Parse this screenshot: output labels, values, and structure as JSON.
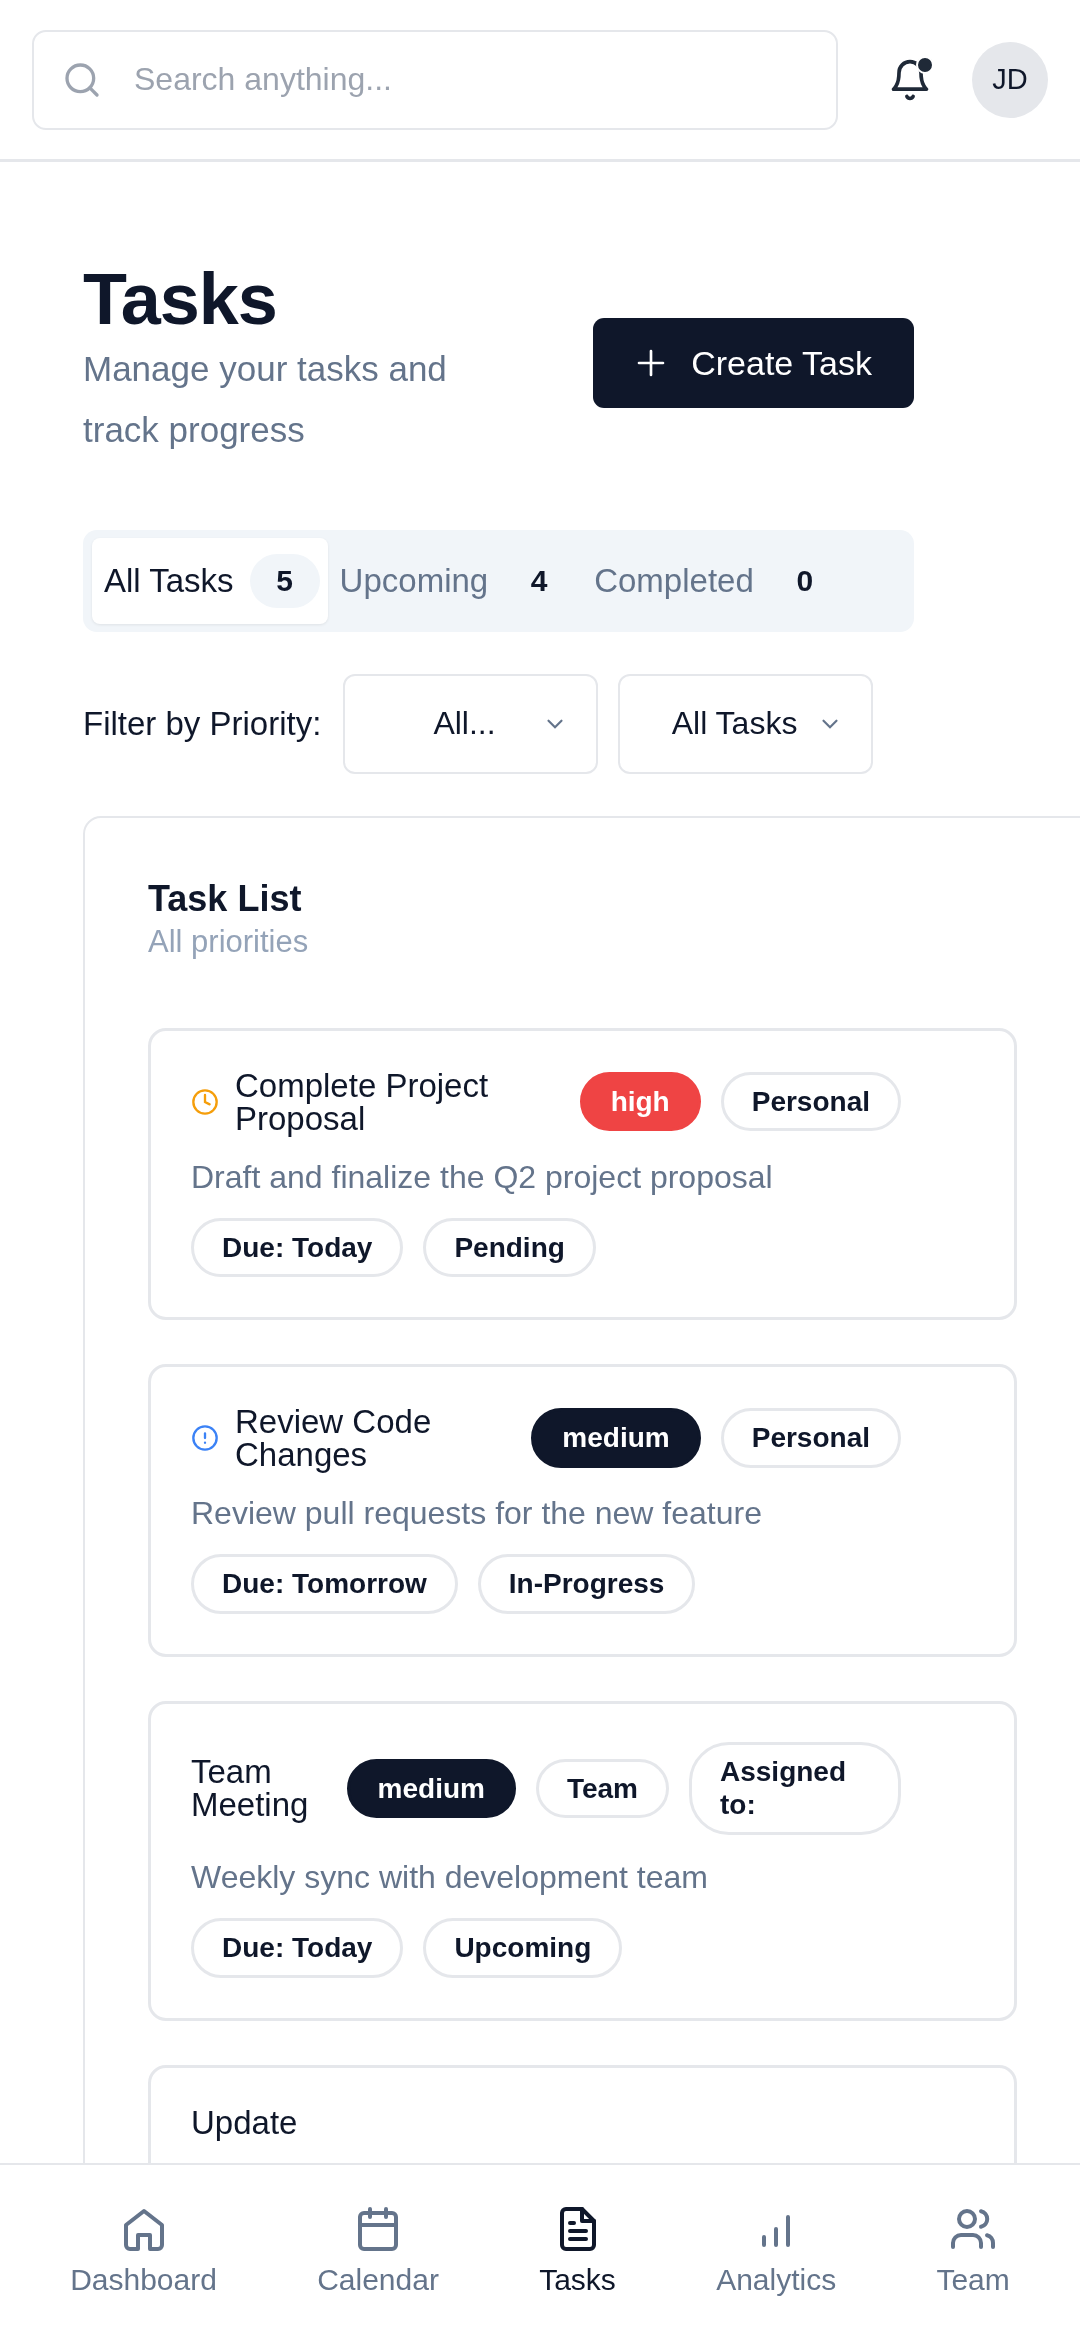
{
  "header": {
    "search": {
      "placeholder": "Search anything..."
    },
    "notifications": {
      "unread": true
    },
    "avatar": {
      "initials": "JD"
    }
  },
  "page": {
    "title": "Tasks",
    "subtitle": "Manage your tasks and track progress",
    "create_button": "Create Task"
  },
  "tabs": [
    {
      "label": "All Tasks",
      "count": "5",
      "selected": true
    },
    {
      "label": "Upcoming",
      "count": "4",
      "selected": false
    },
    {
      "label": "Completed",
      "count": "0",
      "selected": false
    }
  ],
  "filters": {
    "label": "Filter by Priority:",
    "selects": [
      {
        "value": "All..."
      },
      {
        "value": "All Tasks"
      }
    ]
  },
  "task_list": {
    "title": "Task List",
    "subtitle": "All priorities",
    "tasks": [
      {
        "kind": "pending",
        "title": "Complete Project Proposal",
        "priority": "high",
        "tags": [
          "Personal"
        ],
        "description": "Draft and finalize the Q2 project proposal",
        "meta": [
          "Due: Today",
          "Pending"
        ]
      },
      {
        "kind": "in_progress",
        "title": "Review Code Changes",
        "priority": "medium",
        "tags": [
          "Personal"
        ],
        "description": "Review pull requests for the new feature",
        "meta": [
          "Due: Tomorrow",
          "In-Progress"
        ]
      },
      {
        "title": "Team Meeting",
        "priority": "medium",
        "tags": [
          "Team",
          "Assigned to:"
        ],
        "description": "Weekly sync with development team",
        "meta": [
          "Due: Today",
          "Upcoming"
        ]
      },
      {
        "title": "Update"
      }
    ]
  },
  "bottom_nav": [
    {
      "label": "Dashboard",
      "selected": false
    },
    {
      "label": "Calendar",
      "selected": false
    },
    {
      "label": "Tasks",
      "selected": true
    },
    {
      "label": "Analytics",
      "selected": false
    },
    {
      "label": "Team",
      "selected": false
    }
  ]
}
